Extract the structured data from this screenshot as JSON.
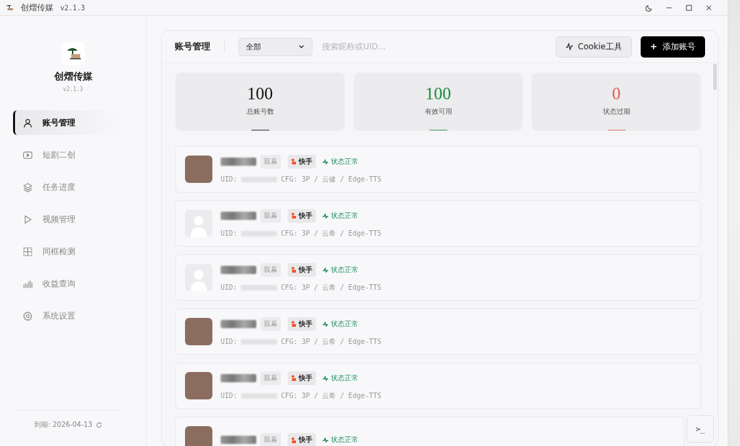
{
  "window": {
    "title": "创熠传媒",
    "version": "v2.1.3"
  },
  "sidebar": {
    "brand": "创熠传媒",
    "version": "v2.1.3",
    "items": [
      {
        "label": "账号管理",
        "selected": true
      },
      {
        "label": "短剧二创",
        "selected": false
      },
      {
        "label": "任务进度",
        "selected": false
      },
      {
        "label": "视频管理",
        "selected": false
      },
      {
        "label": "同框检测",
        "selected": false
      },
      {
        "label": "收益查询",
        "selected": false
      },
      {
        "label": "系统设置",
        "selected": false
      }
    ],
    "expiry": "到期: 2026-04-13"
  },
  "header": {
    "title": "账号管理",
    "filter": "全部",
    "search_placeholder": "搜索昵称或UID...",
    "cookie_button": "Cookie工具",
    "add_button": "添加账号"
  },
  "stats": [
    {
      "value": "100",
      "label": "总账号数",
      "color": "#111111"
    },
    {
      "value": "100",
      "label": "有效可用",
      "color": "#1a8a3a"
    },
    {
      "value": "0",
      "label": "状态过期",
      "color": "#e05a4f"
    }
  ],
  "accounts": [
    {
      "kind": "photo",
      "tag": "双幕",
      "platform": "快手",
      "status": "状态正常",
      "uid_label": "UID:",
      "cfg": "CFG: 3P / 云健 / Edge-TTS"
    },
    {
      "kind": "default",
      "tag": "双幕",
      "platform": "快手",
      "status": "状态正常",
      "uid_label": "UID:",
      "cfg": "CFG: 3P / 云希 / Edge-TTS"
    },
    {
      "kind": "default",
      "tag": "双幕",
      "platform": "快手",
      "status": "状态正常",
      "uid_label": "UID:",
      "cfg": "CFG: 3P / 云希 / Edge-TTS"
    },
    {
      "kind": "photo",
      "tag": "双幕",
      "platform": "快手",
      "status": "状态正常",
      "uid_label": "UID:",
      "cfg": "CFG: 3P / 云希 / Edge-TTS"
    },
    {
      "kind": "photo",
      "tag": "双幕",
      "platform": "快手",
      "status": "状态正常",
      "uid_label": "UID:",
      "cfg": "CFG: 3P / 云希 / Edge-TTS"
    },
    {
      "kind": "photo",
      "tag": "双幕",
      "platform": "快手",
      "status": "状态正常"
    }
  ],
  "terminal_button": ">_"
}
